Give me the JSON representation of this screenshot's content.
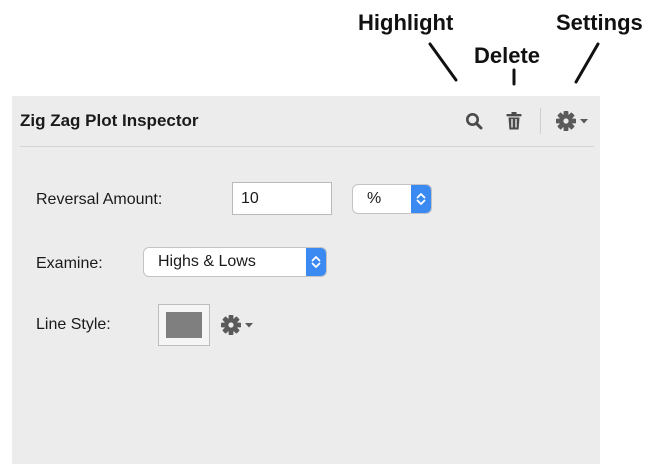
{
  "callouts": {
    "highlight": "Highlight",
    "delete": "Delete",
    "settings": "Settings"
  },
  "inspector": {
    "title": "Zig Zag Plot Inspector",
    "toolbar": {
      "highlight_icon": "magnifier-icon",
      "delete_icon": "trash-icon",
      "settings_icon": "gear-dropdown-icon"
    },
    "reversal": {
      "label": "Reversal Amount:",
      "value": "10",
      "unit": "%"
    },
    "examine": {
      "label": "Examine:",
      "value": "Highs & Lows"
    },
    "line_style": {
      "label": "Line Style:",
      "color": "#7f7f7f"
    }
  },
  "colors": {
    "panel_bg": "#ececec",
    "accent": "#3b8af2",
    "icon": "#5a5a5a"
  }
}
